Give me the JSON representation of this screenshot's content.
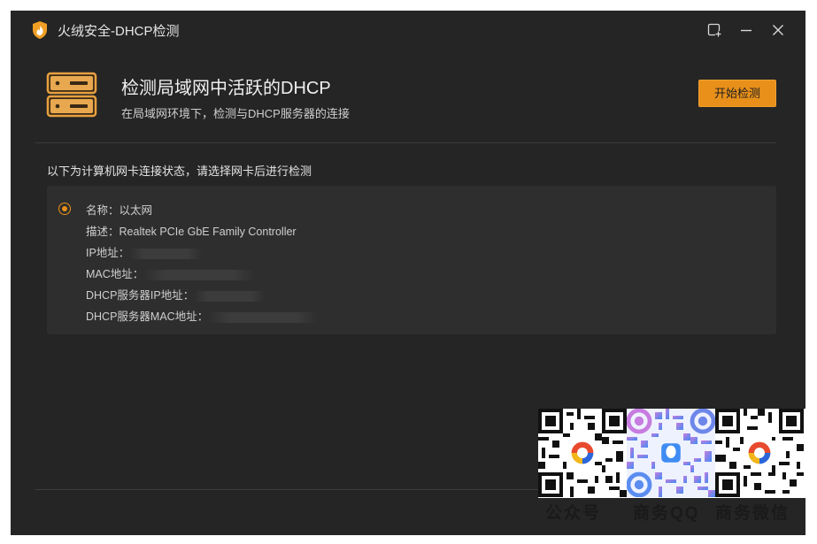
{
  "window": {
    "title": "火绒安全-DHCP检测"
  },
  "header": {
    "title": "检测局域网中活跃的DHCP",
    "subtitle": "在局域网环境下，检测与DHCP服务器的连接",
    "start_button": "开始检测"
  },
  "prompt": "以下为计算机网卡连接状态，请选择网卡后进行检测",
  "adapter": {
    "name_label": "名称：",
    "name_value": "以太网",
    "desc_label": "描述：",
    "desc_value": "Realtek PCIe GbE Family Controller",
    "ip_label": "IP地址：",
    "mac_label": "MAC地址：",
    "dhcp_ip_label": "DHCP服务器IP地址：",
    "dhcp_mac_label": "DHCP服务器MAC地址："
  },
  "overlay": {
    "labels": [
      "公众号",
      "商务QQ",
      "商务微信"
    ]
  },
  "colors": {
    "accent": "#e8901a",
    "window_bg": "#252525",
    "card_bg": "#2e2e2e"
  },
  "icons": [
    "huorong-shield-icon",
    "server-icon",
    "pin-window-icon",
    "minimize-icon",
    "close-icon",
    "radio-selected-icon"
  ]
}
